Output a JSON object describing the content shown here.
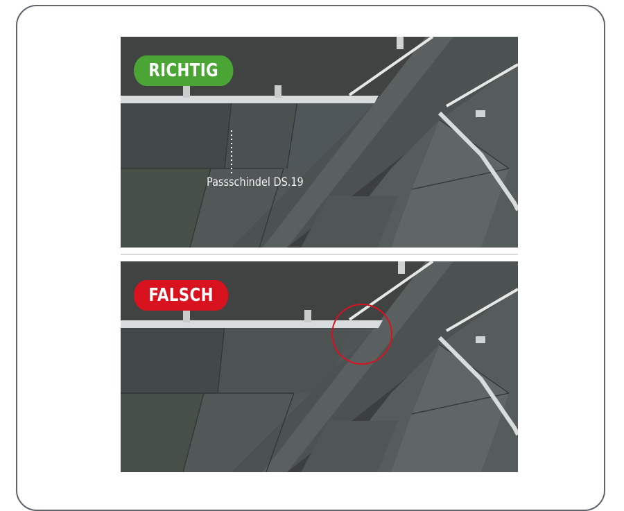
{
  "panels": {
    "correct": {
      "badge_label": "RICHTIG",
      "callout_label": "Passschindel DS.19",
      "badge_color": "#4aa534"
    },
    "wrong": {
      "badge_label": "FALSCH",
      "badge_color": "#d8121f",
      "marker_color": "#d8121f"
    }
  },
  "colors": {
    "frame_border": "#5f646b",
    "roof_gray": "#4a5050",
    "metal_edge": "#d9dcdc"
  }
}
